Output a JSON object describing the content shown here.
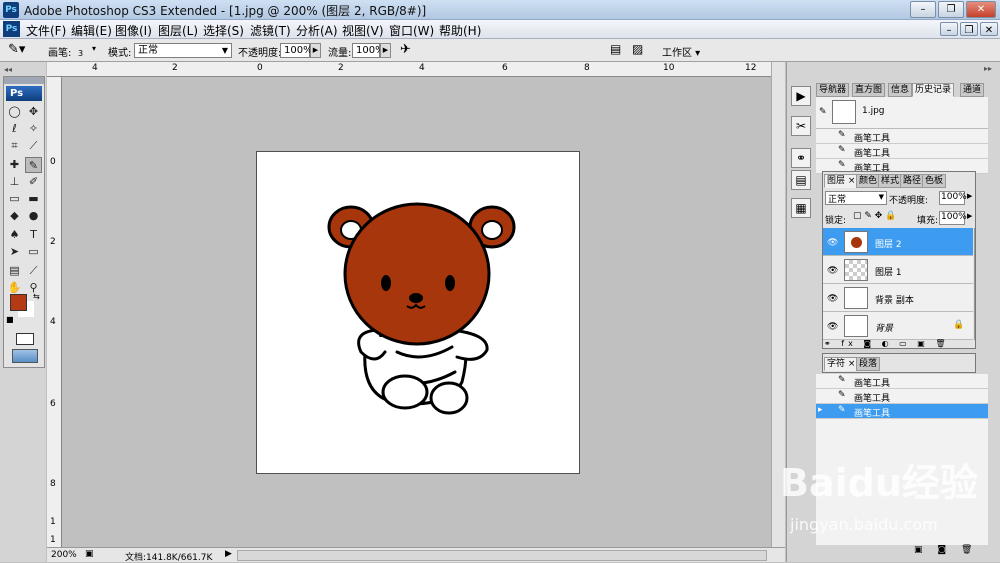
{
  "window": {
    "app_icon": "Ps",
    "title": "Adobe Photoshop CS3 Extended - [1.jpg @ 200% (图层 2, RGB/8#)]",
    "buttons": {
      "minimize": "–",
      "restore": "❐",
      "close": "✕"
    }
  },
  "menubar": {
    "items": [
      "文件(F)",
      "编辑(E)",
      "图像(I)",
      "图层(L)",
      "选择(S)",
      "滤镜(T)",
      "分析(A)",
      "视图(V)",
      "窗口(W)",
      "帮助(H)"
    ]
  },
  "options": {
    "brush_label": "画笔:",
    "brush_size": "3",
    "mode_label": "模式:",
    "mode_value": "正常",
    "opacity_label": "不透明度:",
    "opacity_value": "100%",
    "flow_label": "流量:",
    "flow_value": "100%",
    "workspace_label": "工作区 ▾"
  },
  "toolbox": {
    "logo": "Ps"
  },
  "ruler": {
    "h_ticks": [
      "4",
      "2",
      "0",
      "2",
      "4",
      "6",
      "8",
      "10",
      "12"
    ],
    "v_ticks": [
      "0",
      "2",
      "4",
      "6",
      "8",
      "1",
      "1"
    ]
  },
  "status": {
    "zoom": "200%",
    "doc_info": "文档:141.8K/661.7K"
  },
  "history_panel": {
    "tabs": [
      "导航器",
      "直方图",
      "信息",
      "历史记录",
      "通道"
    ],
    "active_tab": "历史记录",
    "snapshot": "1.jpg",
    "items_top": [
      "画笔工具",
      "画笔工具",
      "画笔工具"
    ],
    "items_bottom": [
      "画笔工具",
      "画笔工具",
      "画笔工具"
    ]
  },
  "layers_panel": {
    "tabs": [
      "图层 ×",
      "颜色",
      "样式",
      "路径",
      "色板"
    ],
    "blend_mode": "正常",
    "opacity_label": "不透明度:",
    "opacity_value": "100%",
    "lock_label": "锁定:",
    "fill_label": "填充:",
    "fill_value": "100%",
    "layers": [
      {
        "name": "图层 2",
        "selected": true
      },
      {
        "name": "图层 1",
        "selected": false
      },
      {
        "name": "背景 副本",
        "selected": false
      },
      {
        "name": "背景",
        "selected": false
      }
    ]
  },
  "char_panel": {
    "tabs": [
      "字符 ×",
      "段落"
    ]
  },
  "colors": {
    "foreground": "#b33a12",
    "background": "#ffffff",
    "highlight": "#3d9cf0",
    "bear": "#a8360c"
  },
  "watermark": {
    "text": "Baidu经验",
    "subtext": "jingyan.baidu.com"
  }
}
